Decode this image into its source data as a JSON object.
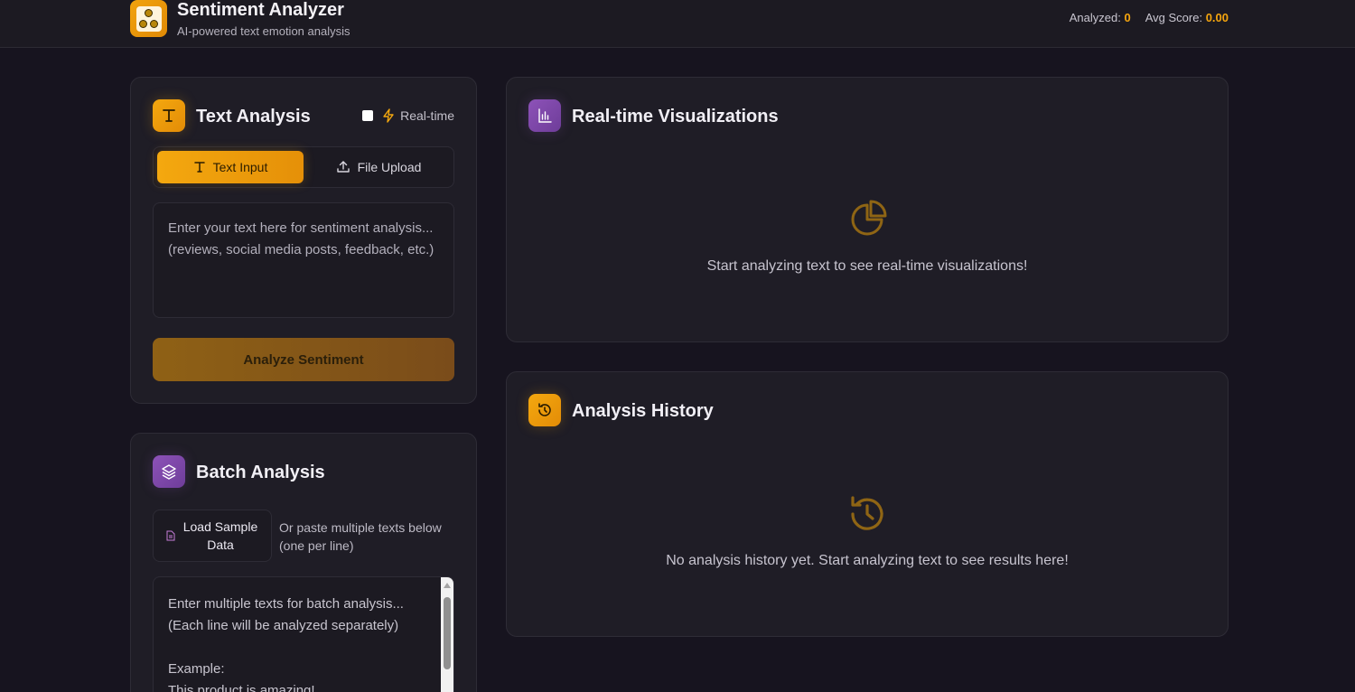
{
  "header": {
    "title": "Sentiment Analyzer",
    "subtitle": "AI-powered text emotion analysis",
    "stats": {
      "analyzed_label": "Analyzed:",
      "analyzed_value": "0",
      "avg_label": "Avg Score:",
      "avg_value": "0.00"
    }
  },
  "text_analysis": {
    "title": "Text Analysis",
    "realtime_label": "Real-time",
    "realtime_checked": false,
    "tabs": [
      {
        "label": "Text Input",
        "active": true,
        "icon": "text-icon"
      },
      {
        "label": "File Upload",
        "active": false,
        "icon": "upload-icon"
      }
    ],
    "input_placeholder": "Enter your text here for sentiment analysis... (reviews, social media posts, feedback, etc.)",
    "analyze_button": "Analyze Sentiment"
  },
  "batch": {
    "title": "Batch Analysis",
    "load_button": "Load Sample Data",
    "hint": "Or paste multiple texts below (one per line)",
    "placeholder_lines": [
      "Enter multiple texts for batch analysis...",
      "(Each line will be analyzed separately)",
      "",
      "Example:",
      "This product is amazing!"
    ]
  },
  "visualizations": {
    "title": "Real-time Visualizations",
    "empty": "Start analyzing text to see real-time visualizations!"
  },
  "history": {
    "title": "Analysis History",
    "empty": "No analysis history yet. Start analyzing text to see results here!"
  },
  "colors": {
    "accent": "#f4a80f",
    "purple": "#8d52b8",
    "background": "#17141f",
    "card": "#1f1d26"
  }
}
